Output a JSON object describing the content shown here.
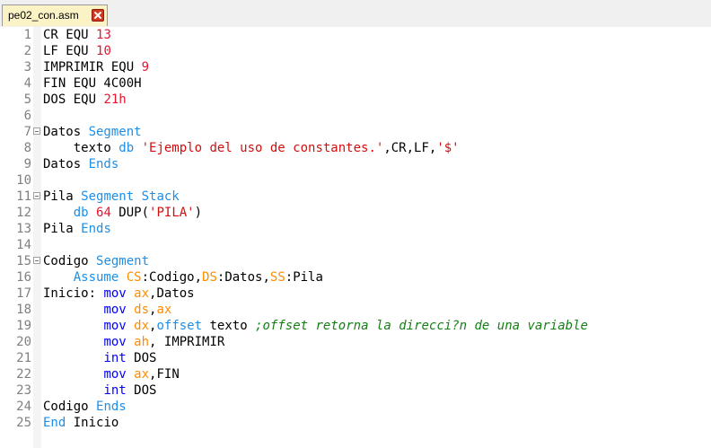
{
  "tab": {
    "label": "pe02_con.asm",
    "close_icon": "close-icon"
  },
  "colors": {
    "number": "#e8142e",
    "keyword": "#1f8ee6",
    "instruction": "#0000ff",
    "register": "#ff8c00",
    "string": "#d01010",
    "comment": "#148014",
    "plain": "#000000"
  },
  "editor": {
    "lines": [
      {
        "n": "1",
        "fold": false,
        "tokens": [
          {
            "t": "CR EQU ",
            "c": "plain"
          },
          {
            "t": "13",
            "c": "number"
          }
        ]
      },
      {
        "n": "2",
        "fold": false,
        "tokens": [
          {
            "t": "LF EQU ",
            "c": "plain"
          },
          {
            "t": "10",
            "c": "number"
          }
        ]
      },
      {
        "n": "3",
        "fold": false,
        "tokens": [
          {
            "t": "IMPRIMIR EQU ",
            "c": "plain"
          },
          {
            "t": "9",
            "c": "number"
          }
        ]
      },
      {
        "n": "4",
        "fold": false,
        "tokens": [
          {
            "t": "FIN EQU 4C00H",
            "c": "plain"
          }
        ]
      },
      {
        "n": "5",
        "fold": false,
        "tokens": [
          {
            "t": "DOS EQU ",
            "c": "plain"
          },
          {
            "t": "21h",
            "c": "number"
          }
        ]
      },
      {
        "n": "6",
        "fold": false,
        "tokens": []
      },
      {
        "n": "7",
        "fold": true,
        "tokens": [
          {
            "t": "Datos ",
            "c": "plain"
          },
          {
            "t": "Segment",
            "c": "keyword"
          }
        ]
      },
      {
        "n": "8",
        "fold": false,
        "tokens": [
          {
            "t": "    texto ",
            "c": "plain"
          },
          {
            "t": "db",
            "c": "keyword"
          },
          {
            "t": " ",
            "c": "plain"
          },
          {
            "t": "'Ejemplo del uso de constantes.'",
            "c": "string"
          },
          {
            "t": ",CR,LF,",
            "c": "plain"
          },
          {
            "t": "'$'",
            "c": "string"
          }
        ]
      },
      {
        "n": "9",
        "fold": false,
        "tokens": [
          {
            "t": "Datos ",
            "c": "plain"
          },
          {
            "t": "Ends",
            "c": "keyword"
          }
        ]
      },
      {
        "n": "10",
        "fold": false,
        "tokens": []
      },
      {
        "n": "11",
        "fold": true,
        "tokens": [
          {
            "t": "Pila ",
            "c": "plain"
          },
          {
            "t": "Segment Stack",
            "c": "keyword"
          }
        ]
      },
      {
        "n": "12",
        "fold": false,
        "tokens": [
          {
            "t": "    ",
            "c": "plain"
          },
          {
            "t": "db",
            "c": "keyword"
          },
          {
            "t": " ",
            "c": "plain"
          },
          {
            "t": "64",
            "c": "number"
          },
          {
            "t": " DUP(",
            "c": "plain"
          },
          {
            "t": "'PILA'",
            "c": "string"
          },
          {
            "t": ")",
            "c": "plain"
          }
        ]
      },
      {
        "n": "13",
        "fold": false,
        "tokens": [
          {
            "t": "Pila ",
            "c": "plain"
          },
          {
            "t": "Ends",
            "c": "keyword"
          }
        ]
      },
      {
        "n": "14",
        "fold": false,
        "tokens": []
      },
      {
        "n": "15",
        "fold": true,
        "tokens": [
          {
            "t": "Codigo ",
            "c": "plain"
          },
          {
            "t": "Segment",
            "c": "keyword"
          }
        ]
      },
      {
        "n": "16",
        "fold": false,
        "tokens": [
          {
            "t": "    ",
            "c": "plain"
          },
          {
            "t": "Assume",
            "c": "keyword"
          },
          {
            "t": " ",
            "c": "plain"
          },
          {
            "t": "CS",
            "c": "register"
          },
          {
            "t": ":Codigo,",
            "c": "plain"
          },
          {
            "t": "DS",
            "c": "register"
          },
          {
            "t": ":Datos,",
            "c": "plain"
          },
          {
            "t": "SS",
            "c": "register"
          },
          {
            "t": ":Pila",
            "c": "plain"
          }
        ]
      },
      {
        "n": "17",
        "fold": false,
        "tokens": [
          {
            "t": "Inicio: ",
            "c": "plain"
          },
          {
            "t": "mov",
            "c": "instruction"
          },
          {
            "t": " ",
            "c": "plain"
          },
          {
            "t": "ax",
            "c": "register"
          },
          {
            "t": ",Datos",
            "c": "plain"
          }
        ]
      },
      {
        "n": "18",
        "fold": false,
        "tokens": [
          {
            "t": "        ",
            "c": "plain"
          },
          {
            "t": "mov",
            "c": "instruction"
          },
          {
            "t": " ",
            "c": "plain"
          },
          {
            "t": "ds",
            "c": "register"
          },
          {
            "t": ",",
            "c": "plain"
          },
          {
            "t": "ax",
            "c": "register"
          }
        ]
      },
      {
        "n": "19",
        "fold": false,
        "tokens": [
          {
            "t": "        ",
            "c": "plain"
          },
          {
            "t": "mov",
            "c": "instruction"
          },
          {
            "t": " ",
            "c": "plain"
          },
          {
            "t": "dx",
            "c": "register"
          },
          {
            "t": ",",
            "c": "plain"
          },
          {
            "t": "offset",
            "c": "keyword"
          },
          {
            "t": " texto ",
            "c": "plain"
          },
          {
            "t": ";offset retorna la direcci?n de una variable",
            "c": "comment"
          }
        ]
      },
      {
        "n": "20",
        "fold": false,
        "tokens": [
          {
            "t": "        ",
            "c": "plain"
          },
          {
            "t": "mov",
            "c": "instruction"
          },
          {
            "t": " ",
            "c": "plain"
          },
          {
            "t": "ah",
            "c": "register"
          },
          {
            "t": ", IMPRIMIR",
            "c": "plain"
          }
        ]
      },
      {
        "n": "21",
        "fold": false,
        "tokens": [
          {
            "t": "        ",
            "c": "plain"
          },
          {
            "t": "int",
            "c": "instruction"
          },
          {
            "t": " DOS",
            "c": "plain"
          }
        ]
      },
      {
        "n": "22",
        "fold": false,
        "tokens": [
          {
            "t": "        ",
            "c": "plain"
          },
          {
            "t": "mov",
            "c": "instruction"
          },
          {
            "t": " ",
            "c": "plain"
          },
          {
            "t": "ax",
            "c": "register"
          },
          {
            "t": ",FIN",
            "c": "plain"
          }
        ]
      },
      {
        "n": "23",
        "fold": false,
        "tokens": [
          {
            "t": "        ",
            "c": "plain"
          },
          {
            "t": "int",
            "c": "instruction"
          },
          {
            "t": " DOS",
            "c": "plain"
          }
        ]
      },
      {
        "n": "24",
        "fold": false,
        "tokens": [
          {
            "t": "Codigo ",
            "c": "plain"
          },
          {
            "t": "Ends",
            "c": "keyword"
          }
        ]
      },
      {
        "n": "25",
        "fold": false,
        "tokens": [
          {
            "t": "End",
            "c": "keyword"
          },
          {
            "t": " Inicio",
            "c": "plain"
          }
        ]
      }
    ]
  }
}
